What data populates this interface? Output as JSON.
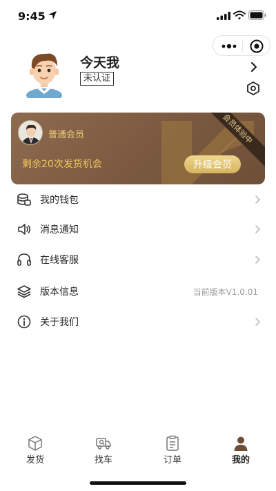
{
  "status_bar": {
    "time": "9:45"
  },
  "profile": {
    "username": "今天我",
    "verification_badge": "未认证"
  },
  "member_card": {
    "ribbon": "会员体验中",
    "level": "普通会员",
    "remaining": "剩余20次发货机会",
    "upgrade_label": "升级会员"
  },
  "menu": [
    {
      "label": "我的钱包",
      "icon": "wallet-icon"
    },
    {
      "label": "消息通知",
      "icon": "speaker-icon"
    },
    {
      "label": "在线客服",
      "icon": "headset-icon"
    },
    {
      "label": "版本信息",
      "icon": "layers-icon",
      "value": "当前版本V1.0.01"
    },
    {
      "label": "关于我们",
      "icon": "info-icon"
    }
  ],
  "tab_bar": {
    "tabs": [
      {
        "label": "发货",
        "icon": "box-icon"
      },
      {
        "label": "找车",
        "icon": "truck-icon"
      },
      {
        "label": "订单",
        "icon": "clipboard-icon"
      },
      {
        "label": "我的",
        "icon": "person-icon",
        "active": true
      }
    ]
  },
  "colors": {
    "card_gradient_start": "#8e6b4f",
    "card_gradient_end": "#6e4f37",
    "gold_text": "#f3c65d",
    "upgrade_button": "#e3c676"
  }
}
